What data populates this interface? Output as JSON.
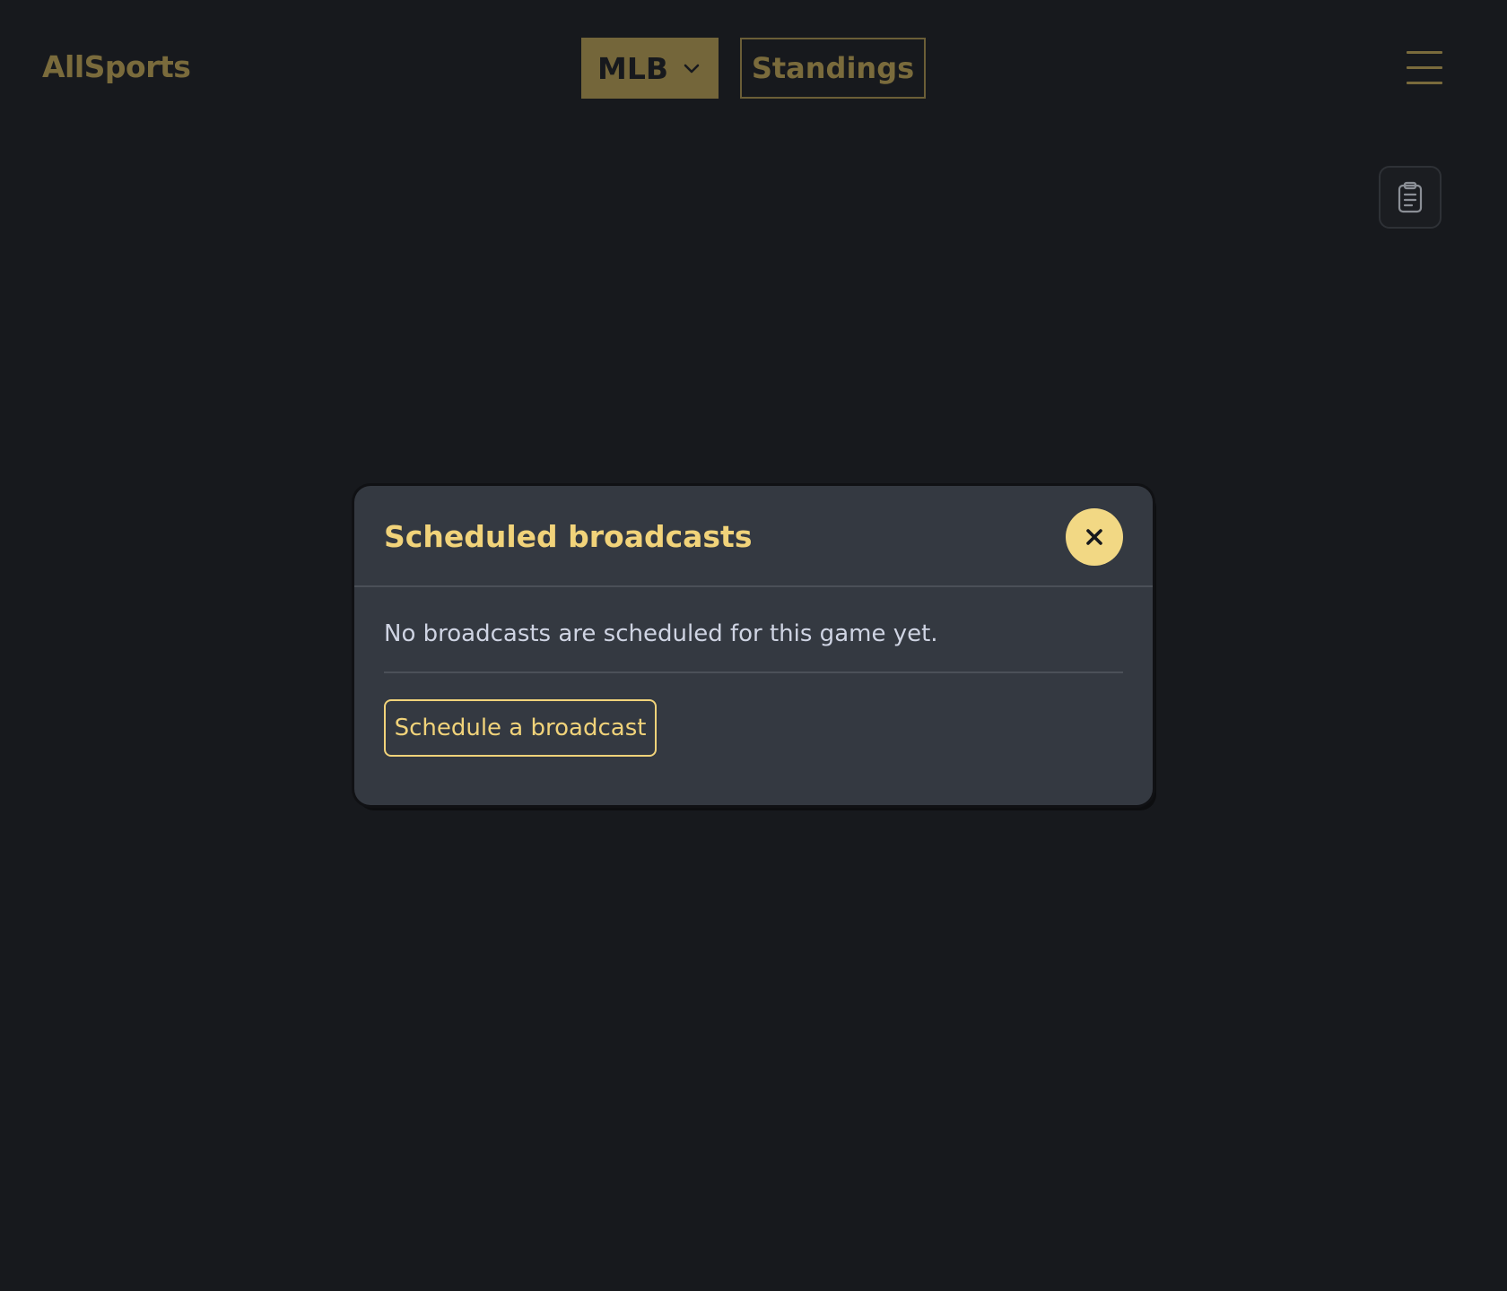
{
  "header": {
    "brand": "AllSports",
    "league_label": "MLB",
    "standings_label": "Standings",
    "menu_icon": "hamburger-menu-icon",
    "chevron_icon": "chevron-down-icon"
  },
  "toolbar": {
    "clipboard_icon": "clipboard-icon"
  },
  "modal": {
    "title": "Scheduled broadcasts",
    "close_icon": "close-icon",
    "empty_message": "No broadcasts are scheduled for this game yet.",
    "schedule_button_label": "Schedule a broadcast"
  },
  "colors": {
    "background": "#17191d",
    "accent": "#f1d37a",
    "accent_dim": "#7a6b3c",
    "modal_background": "#343941"
  }
}
